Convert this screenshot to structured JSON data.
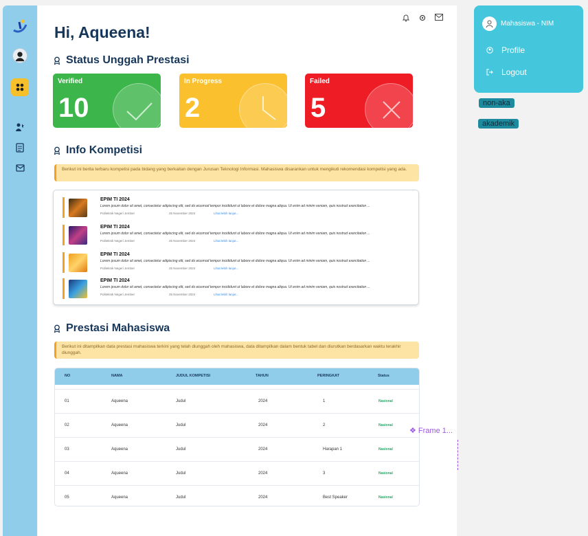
{
  "header": {
    "greeting": "Hi, Aqueena!"
  },
  "status_section": {
    "title": "Status Unggah Prestasi",
    "cards": [
      {
        "label": "Verified",
        "value": "10",
        "color": "#3cb54a"
      },
      {
        "label": "In Progress",
        "value": "2",
        "color": "#fbc02d"
      },
      {
        "label": "Failed",
        "value": "5",
        "color": "#ee1c25"
      }
    ]
  },
  "kompetisi_section": {
    "title": "Info Kompetisi",
    "notice": "Berikut ini berita terbaru kompetisi pada bidang yang berkaitan dengan Jurusan Teknologi Informasi. Mahasiswa disarankan untuk mengikuti rekomendasi kompetisi yang ada.",
    "items": [
      {
        "title": "EPIM TI 2024",
        "desc": "Lorem ipsum dolor sit amet, consectetur adipiscing elit, sed do eiusmod tempor incididunt ut labore et dolore magna aliqua. Ut enim ad minim veniam, quis nostrud exercitation ...",
        "org": "Politeknik Negeri Jember",
        "date": "25 November 2024",
        "link": "Lihat lebih lanjut..."
      },
      {
        "title": "EPIM TI 2024",
        "desc": "Lorem ipsum dolor sit amet, consectetur adipiscing elit, sed do eiusmod tempor incididunt ut labore et dolore magna aliqua. Ut enim ad minim veniam, quis nostrud exercitation ...",
        "org": "Politeknik Negeri Jember",
        "date": "25 November 2024",
        "link": "Lihat lebih lanjut..."
      },
      {
        "title": "EPIM TI 2024",
        "desc": "Lorem ipsum dolor sit amet, consectetur adipiscing elit, sed do eiusmod tempor incididunt ut labore et dolore magna aliqua. Ut enim ad minim veniam, quis nostrud exercitation ...",
        "org": "Politeknik Negeri Jember",
        "date": "25 November 2024",
        "link": "Lihat lebih lanjut..."
      },
      {
        "title": "EPIM TI 2024",
        "desc": "Lorem ipsum dolor sit amet, consectetur adipiscing elit, sed do eiusmod tempor incididunt ut labore et dolore magna aliqua. Ut enim ad minim veniam, quis nostrud exercitation ...",
        "org": "Politeknik Negeri Jember",
        "date": "25 November 2024",
        "link": "Lihat lebih lanjut..."
      }
    ]
  },
  "prestasi_section": {
    "title": "Prestasi Mahasiswa",
    "notice": "Berikut ini ditampilkan data prestasi mahasiswa terkini yang telah diunggah oleh mahasiswa, data ditampilkan dalam bentuk tabel dan diurutkan berdasarkan waktu terakhir diunggah.",
    "columns": [
      "NO",
      "NAMA",
      "JUDUL KOMPETISI",
      "TAHUN",
      "PERINGKAT",
      "Status"
    ],
    "rows": [
      [
        "01",
        "Aqueena",
        "Judul",
        "2024",
        "1",
        "Nasional"
      ],
      [
        "02",
        "Aqueena",
        "Judul",
        "2024",
        "2",
        "Nasional"
      ],
      [
        "03",
        "Aqueena",
        "Judul",
        "2024",
        "Harapan 1",
        "Nasional"
      ],
      [
        "04",
        "Aqueena",
        "Judul",
        "2024",
        "3",
        "Nasional"
      ],
      [
        "05",
        "Aqueena",
        "Judul",
        "2024",
        "Best Speaker",
        "Nasional"
      ]
    ]
  },
  "dropdown": {
    "user": "Mahasiswa - NIM",
    "items": [
      "Profile",
      "Logout"
    ]
  },
  "chips": [
    "non-aka",
    "akademik"
  ],
  "frame_label": "❖ Frame 1..."
}
